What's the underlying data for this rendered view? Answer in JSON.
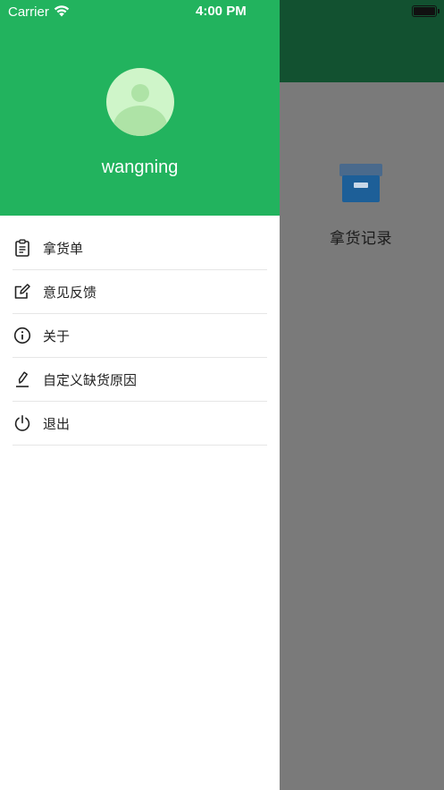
{
  "status_bar": {
    "carrier": "Carrier",
    "time": "4:00 PM"
  },
  "background_page": {
    "tile": {
      "icon": "archive-box-icon",
      "label": "拿货记录"
    }
  },
  "drawer": {
    "avatar": "user-avatar-icon",
    "username": "wangning",
    "menu": [
      {
        "icon": "clipboard-icon",
        "label": "拿货单"
      },
      {
        "icon": "edit-icon",
        "label": "意见反馈"
      },
      {
        "icon": "info-icon",
        "label": "关于"
      },
      {
        "icon": "pen-icon",
        "label": "自定义缺货原因"
      },
      {
        "icon": "power-icon",
        "label": "退出"
      }
    ]
  },
  "colors": {
    "drawer_header": "#22b35e",
    "navbar_dimmed": "#125130",
    "overlay": "#7a7a7a"
  }
}
